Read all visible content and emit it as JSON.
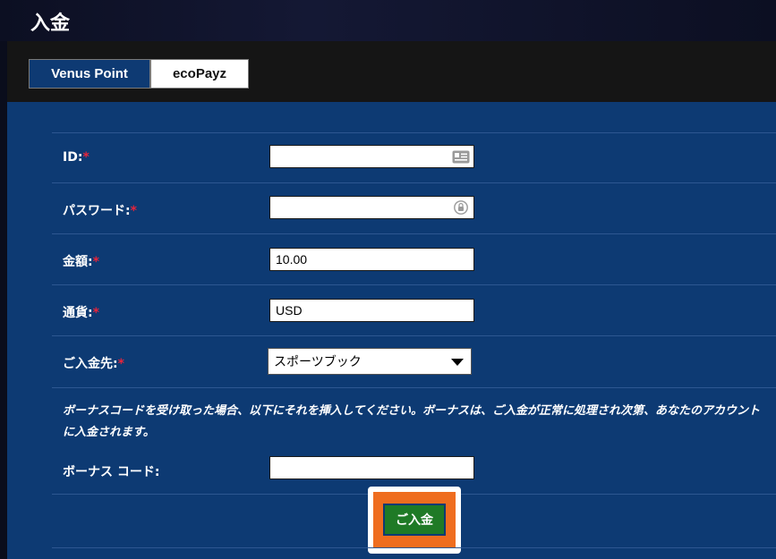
{
  "page": {
    "title": "入金"
  },
  "tabs": [
    {
      "label": "Venus Point",
      "active": true
    },
    {
      "label": "ecoPayz",
      "active": false
    }
  ],
  "form": {
    "required_mark": "*",
    "id": {
      "label": "ID:",
      "value": "",
      "icon": "id-card-icon"
    },
    "password": {
      "label": "パスワード:",
      "value": "",
      "icon": "lock-icon"
    },
    "amount": {
      "label": "金額:",
      "value": "10.00"
    },
    "currency": {
      "label": "通貨:",
      "value": "USD"
    },
    "destination": {
      "label": "ご入金先:",
      "selected": "スポーツブック"
    },
    "notice": "ボーナスコードを受け取った場合、以下にそれを挿入してください。ボーナスは、ご入金が正常に処理され次第、あなたのアカウントに入金されます。",
    "bonus_code": {
      "label": "ボーナス コード:",
      "value": ""
    },
    "submit_label": "ご入金"
  },
  "colors": {
    "panel_bg": "#0d3a73",
    "tab_active": "#0e3a73",
    "required": "#e8243b",
    "submit_bg": "#1f7a26",
    "highlight": "#ef6d1f"
  }
}
